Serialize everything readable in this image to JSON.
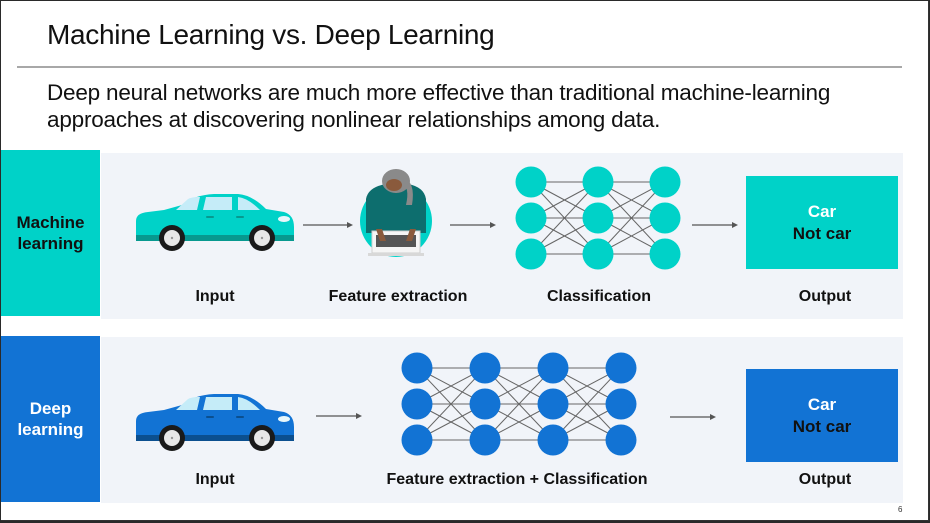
{
  "slide": {
    "title": "Machine Learning vs. Deep Learning",
    "subtitle": "Deep neural networks are much more effective than traditional machine-learning approaches at discovering nonlinear relationships among data.",
    "page_number": "6"
  },
  "colors": {
    "machine_learning": "#00d2c8",
    "deep_learning": "#1273d4",
    "band_background": "#f1f4f9",
    "arrow": "#555555"
  },
  "rows": {
    "machine_learning": {
      "label": "Machine learning",
      "input_caption": "Input",
      "input_icon": "car-icon",
      "feature_caption": "Feature extraction",
      "feature_icon": "person-at-laptop-icon",
      "classification_caption": "Classification",
      "classification_icon": "neural-network-icon",
      "network_layers": 3,
      "nodes_per_layer": 3,
      "output_caption": "Output",
      "output_positive": "Car",
      "output_negative": "Not car"
    },
    "deep_learning": {
      "label": "Deep learning",
      "input_caption": "Input",
      "input_icon": "car-icon",
      "combined_caption": "Feature extraction + Classification",
      "combined_icon": "neural-network-icon",
      "network_layers": 4,
      "nodes_per_layer": 3,
      "output_caption": "Output",
      "output_positive": "Car",
      "output_negative": "Not car"
    }
  }
}
